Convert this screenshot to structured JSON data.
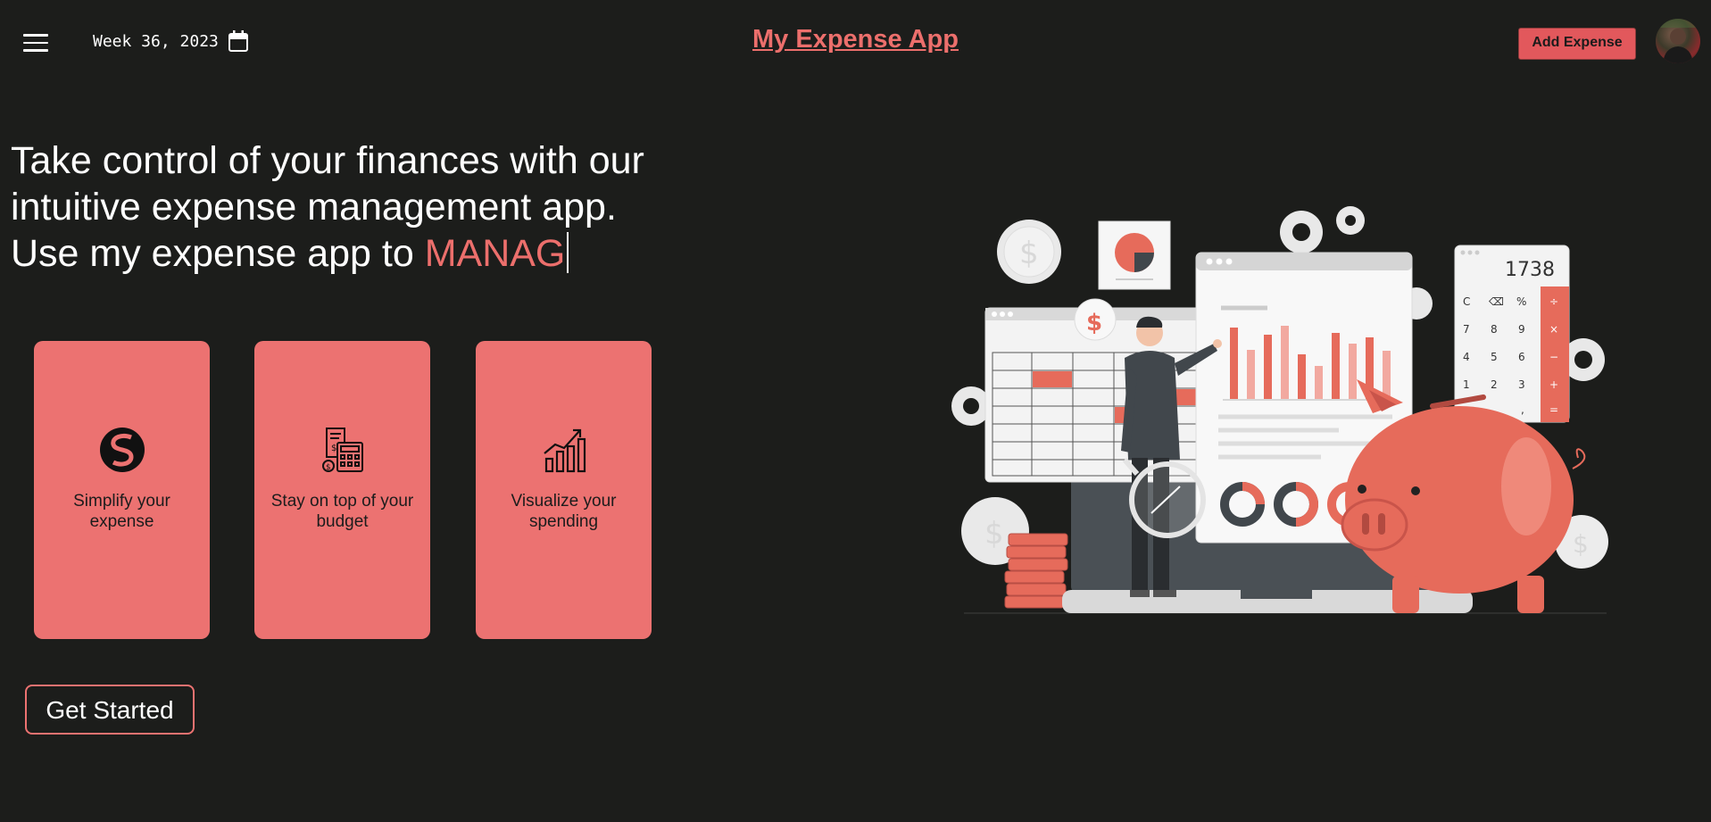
{
  "header": {
    "week_label": "Week 36, 2023",
    "app_title": "My Expense App",
    "add_expense_label": "Add Expense"
  },
  "hero": {
    "line1": "Take control of your finances with our",
    "line2": "intuitive expense management app.",
    "line3_prefix": "Use my expense app to ",
    "typed_word": "MANAG"
  },
  "cards": [
    {
      "icon": "simplify-s-icon",
      "label": "Simplify your expense"
    },
    {
      "icon": "calculator-receipt-icon",
      "label": "Stay on top of your budget"
    },
    {
      "icon": "growth-chart-icon",
      "label": "Visualize your spending"
    }
  ],
  "cta": {
    "label": "Get Started"
  },
  "illustration": {
    "calculator_display": "1738",
    "calculator_keys": [
      "C",
      "⌫",
      "%",
      "÷",
      "7",
      "8",
      "9",
      "×",
      "4",
      "5",
      "6",
      "−",
      "1",
      "2",
      "3",
      "+",
      ",",
      "="
    ],
    "currency_symbol": "$"
  },
  "colors": {
    "background": "#1c1d1b",
    "accent": "#ec6f6c",
    "card": "#ec7271",
    "button": "#e2585c"
  }
}
